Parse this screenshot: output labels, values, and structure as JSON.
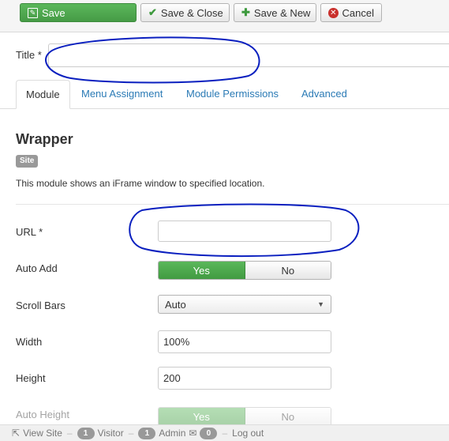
{
  "toolbar": {
    "save_label": "Save",
    "save_close_label": "Save & Close",
    "save_new_label": "Save & New",
    "cancel_label": "Cancel"
  },
  "title_field": {
    "label": "Title *",
    "value": ""
  },
  "tabs": [
    {
      "label": "Module",
      "active": true
    },
    {
      "label": "Menu Assignment",
      "active": false
    },
    {
      "label": "Module Permissions",
      "active": false
    },
    {
      "label": "Advanced",
      "active": false
    }
  ],
  "module": {
    "name": "Wrapper",
    "badge": "Site",
    "description": "This module shows an iFrame window to specified location."
  },
  "form": {
    "url": {
      "label": "URL *",
      "value": ""
    },
    "auto_add": {
      "label": "Auto Add",
      "yes": "Yes",
      "no": "No",
      "selected": "Yes"
    },
    "scroll_bars": {
      "label": "Scroll Bars",
      "value": "Auto"
    },
    "width": {
      "label": "Width",
      "value": "100%"
    },
    "height": {
      "label": "Height",
      "value": "200"
    },
    "auto_height": {
      "label": "Auto Height",
      "yes": "Yes",
      "no": "No",
      "selected": "Yes"
    }
  },
  "status_bar": {
    "view_site": "View Site",
    "visitor_count": "1",
    "visitor_label": "Visitor",
    "admin_count": "1",
    "admin_label": "Admin",
    "messages_count": "0",
    "logout": "Log out"
  },
  "colors": {
    "accent_green": "#5bb75b",
    "link_blue": "#2a7ab5",
    "annotation_blue": "#0a1fbf"
  }
}
